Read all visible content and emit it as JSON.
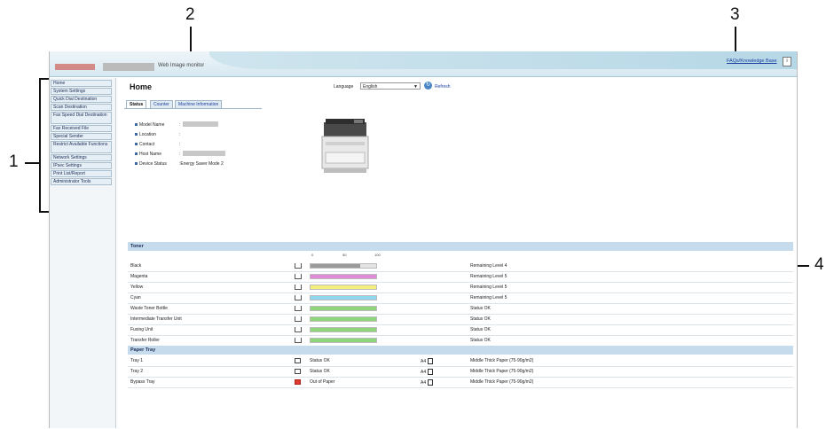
{
  "callouts": [
    "1",
    "2",
    "3",
    "4"
  ],
  "header": {
    "app_title": "Web Image monitor",
    "faq_link": "FAQs/Knowledge Base",
    "help_glyph": "i"
  },
  "sidebar": {
    "items": [
      {
        "label": "Home"
      },
      {
        "label": "System Settings"
      },
      {
        "label": "Quick Dial Destination"
      },
      {
        "label": "Scan Destination"
      },
      {
        "label": "Fax Speed Dial Destination"
      },
      {
        "label": "Fax Received File"
      },
      {
        "label": "Special Sender"
      },
      {
        "label": "Restrict Available Functions"
      },
      {
        "label": "Network Settings"
      },
      {
        "label": "IPsec Settings"
      },
      {
        "label": "Print List/Report"
      },
      {
        "label": "Administrator Tools"
      }
    ]
  },
  "main": {
    "title": "Home",
    "language_label": "Language",
    "language_value": "English",
    "refresh_label": "Refresh",
    "tabs": [
      {
        "label": "Status",
        "active": true
      },
      {
        "label": "Counter",
        "active": false
      },
      {
        "label": "Machine Information",
        "active": false
      }
    ],
    "device_info": [
      {
        "label": "Model Name",
        "value": ":"
      },
      {
        "label": "Location",
        "value": ":"
      },
      {
        "label": "Contact",
        "value": ":"
      },
      {
        "label": "Host Name",
        "value": ":"
      },
      {
        "label": "Device Status",
        "value": ":Energy Saver Mode 2"
      }
    ]
  },
  "toner": {
    "title": "Toner",
    "scale": [
      "0",
      "50",
      "100"
    ],
    "rows": [
      {
        "name": "Black",
        "level": 0.75,
        "color": "#9a9a9a",
        "status": "Remaining Level 4"
      },
      {
        "name": "Magenta",
        "level": 1.0,
        "color": "#e08ad8",
        "status": "Remaining Level 5"
      },
      {
        "name": "Yellow",
        "level": 1.0,
        "color": "#f4ee7c",
        "status": "Remaining Level 5"
      },
      {
        "name": "Cyan",
        "level": 1.0,
        "color": "#8fd6ee",
        "status": "Remaining Level 5"
      },
      {
        "name": "Waste Toner Bottle",
        "level": 1.0,
        "color": "#8ed57c",
        "status": "Status OK"
      },
      {
        "name": "Intermediate Transfer Unit",
        "level": 1.0,
        "color": "#8ed57c",
        "status": "Status OK"
      },
      {
        "name": "Fusing Unit",
        "level": 1.0,
        "color": "#8ed57c",
        "status": "Status OK"
      },
      {
        "name": "Transfer Roller",
        "level": 1.0,
        "color": "#8ed57c",
        "status": "Status OK"
      }
    ]
  },
  "paper_tray": {
    "title": "Paper Tray",
    "rows": [
      {
        "name": "Tray 1",
        "status": "Status OK",
        "size": "A4",
        "paper": "Middle Thick Paper (75-90g/m2)",
        "alert": false
      },
      {
        "name": "Tray 2",
        "status": "Status OK",
        "size": "A4",
        "paper": "Middle Thick Paper (75-90g/m2)",
        "alert": false
      },
      {
        "name": "Bypass Tray",
        "status": "Out of Paper",
        "size": "A4",
        "paper": "Middle Thick Paper (75-90g/m2)",
        "alert": true
      }
    ]
  }
}
